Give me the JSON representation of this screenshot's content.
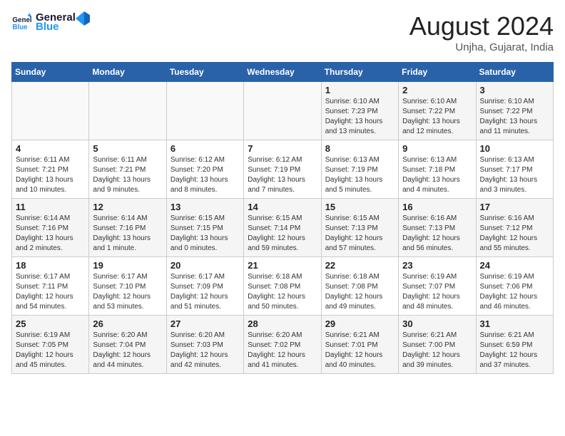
{
  "header": {
    "logo_text_general": "General",
    "logo_text_blue": "Blue",
    "month_year": "August 2024",
    "location": "Unjha, Gujarat, India"
  },
  "weekdays": [
    "Sunday",
    "Monday",
    "Tuesday",
    "Wednesday",
    "Thursday",
    "Friday",
    "Saturday"
  ],
  "weeks": [
    [
      {
        "day": "",
        "info": ""
      },
      {
        "day": "",
        "info": ""
      },
      {
        "day": "",
        "info": ""
      },
      {
        "day": "",
        "info": ""
      },
      {
        "day": "1",
        "info": "Sunrise: 6:10 AM\nSunset: 7:23 PM\nDaylight: 13 hours\nand 13 minutes."
      },
      {
        "day": "2",
        "info": "Sunrise: 6:10 AM\nSunset: 7:22 PM\nDaylight: 13 hours\nand 12 minutes."
      },
      {
        "day": "3",
        "info": "Sunrise: 6:10 AM\nSunset: 7:22 PM\nDaylight: 13 hours\nand 11 minutes."
      }
    ],
    [
      {
        "day": "4",
        "info": "Sunrise: 6:11 AM\nSunset: 7:21 PM\nDaylight: 13 hours\nand 10 minutes."
      },
      {
        "day": "5",
        "info": "Sunrise: 6:11 AM\nSunset: 7:21 PM\nDaylight: 13 hours\nand 9 minutes."
      },
      {
        "day": "6",
        "info": "Sunrise: 6:12 AM\nSunset: 7:20 PM\nDaylight: 13 hours\nand 8 minutes."
      },
      {
        "day": "7",
        "info": "Sunrise: 6:12 AM\nSunset: 7:19 PM\nDaylight: 13 hours\nand 7 minutes."
      },
      {
        "day": "8",
        "info": "Sunrise: 6:13 AM\nSunset: 7:19 PM\nDaylight: 13 hours\nand 5 minutes."
      },
      {
        "day": "9",
        "info": "Sunrise: 6:13 AM\nSunset: 7:18 PM\nDaylight: 13 hours\nand 4 minutes."
      },
      {
        "day": "10",
        "info": "Sunrise: 6:13 AM\nSunset: 7:17 PM\nDaylight: 13 hours\nand 3 minutes."
      }
    ],
    [
      {
        "day": "11",
        "info": "Sunrise: 6:14 AM\nSunset: 7:16 PM\nDaylight: 13 hours\nand 2 minutes."
      },
      {
        "day": "12",
        "info": "Sunrise: 6:14 AM\nSunset: 7:16 PM\nDaylight: 13 hours\nand 1 minute."
      },
      {
        "day": "13",
        "info": "Sunrise: 6:15 AM\nSunset: 7:15 PM\nDaylight: 13 hours\nand 0 minutes."
      },
      {
        "day": "14",
        "info": "Sunrise: 6:15 AM\nSunset: 7:14 PM\nDaylight: 12 hours\nand 59 minutes."
      },
      {
        "day": "15",
        "info": "Sunrise: 6:15 AM\nSunset: 7:13 PM\nDaylight: 12 hours\nand 57 minutes."
      },
      {
        "day": "16",
        "info": "Sunrise: 6:16 AM\nSunset: 7:13 PM\nDaylight: 12 hours\nand 56 minutes."
      },
      {
        "day": "17",
        "info": "Sunrise: 6:16 AM\nSunset: 7:12 PM\nDaylight: 12 hours\nand 55 minutes."
      }
    ],
    [
      {
        "day": "18",
        "info": "Sunrise: 6:17 AM\nSunset: 7:11 PM\nDaylight: 12 hours\nand 54 minutes."
      },
      {
        "day": "19",
        "info": "Sunrise: 6:17 AM\nSunset: 7:10 PM\nDaylight: 12 hours\nand 53 minutes."
      },
      {
        "day": "20",
        "info": "Sunrise: 6:17 AM\nSunset: 7:09 PM\nDaylight: 12 hours\nand 51 minutes."
      },
      {
        "day": "21",
        "info": "Sunrise: 6:18 AM\nSunset: 7:08 PM\nDaylight: 12 hours\nand 50 minutes."
      },
      {
        "day": "22",
        "info": "Sunrise: 6:18 AM\nSunset: 7:08 PM\nDaylight: 12 hours\nand 49 minutes."
      },
      {
        "day": "23",
        "info": "Sunrise: 6:19 AM\nSunset: 7:07 PM\nDaylight: 12 hours\nand 48 minutes."
      },
      {
        "day": "24",
        "info": "Sunrise: 6:19 AM\nSunset: 7:06 PM\nDaylight: 12 hours\nand 46 minutes."
      }
    ],
    [
      {
        "day": "25",
        "info": "Sunrise: 6:19 AM\nSunset: 7:05 PM\nDaylight: 12 hours\nand 45 minutes."
      },
      {
        "day": "26",
        "info": "Sunrise: 6:20 AM\nSunset: 7:04 PM\nDaylight: 12 hours\nand 44 minutes."
      },
      {
        "day": "27",
        "info": "Sunrise: 6:20 AM\nSunset: 7:03 PM\nDaylight: 12 hours\nand 42 minutes."
      },
      {
        "day": "28",
        "info": "Sunrise: 6:20 AM\nSunset: 7:02 PM\nDaylight: 12 hours\nand 41 minutes."
      },
      {
        "day": "29",
        "info": "Sunrise: 6:21 AM\nSunset: 7:01 PM\nDaylight: 12 hours\nand 40 minutes."
      },
      {
        "day": "30",
        "info": "Sunrise: 6:21 AM\nSunset: 7:00 PM\nDaylight: 12 hours\nand 39 minutes."
      },
      {
        "day": "31",
        "info": "Sunrise: 6:21 AM\nSunset: 6:59 PM\nDaylight: 12 hours\nand 37 minutes."
      }
    ]
  ]
}
